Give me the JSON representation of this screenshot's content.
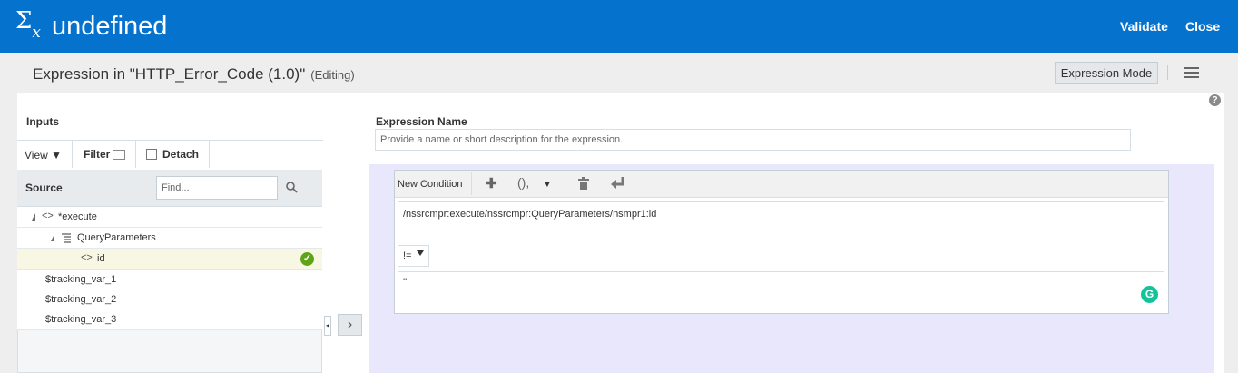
{
  "header": {
    "sigma_symbol": "Σ",
    "sigma_sub": "x",
    "title": "undefined",
    "validate_label": "Validate",
    "close_label": "Close",
    "bg_color": "#0572ce"
  },
  "subheader": {
    "expression_title": "Expression in \"HTTP_Error_Code (1.0)\"",
    "status": "(Editing)",
    "mode_button": "Expression Mode"
  },
  "inputs": {
    "label": "Inputs",
    "toolbar": {
      "view_label": "View",
      "filter_label": "Filter",
      "detach_label": "Detach"
    },
    "source_label": "Source",
    "find_placeholder": "Find...",
    "tree": [
      {
        "label": "*execute",
        "expanded": true
      },
      {
        "label": "QueryParameters",
        "expanded": true
      },
      {
        "label": "id",
        "selected": true,
        "mapped": true
      },
      {
        "label": "$tracking_var_1"
      },
      {
        "label": "$tracking_var_2"
      },
      {
        "label": "$tracking_var_3"
      }
    ]
  },
  "expression": {
    "name_label": "Expression Name",
    "name_placeholder": "Provide a name or short description for the expression.",
    "condition_toolbar": {
      "new_condition_label": "New Condition"
    },
    "left_operand": "/nssrcmpr:execute/nssrcmpr:QueryParameters/nsmpr1:id",
    "operator": "!=",
    "right_operand": "''",
    "panel_color": "#e9e7fb"
  }
}
